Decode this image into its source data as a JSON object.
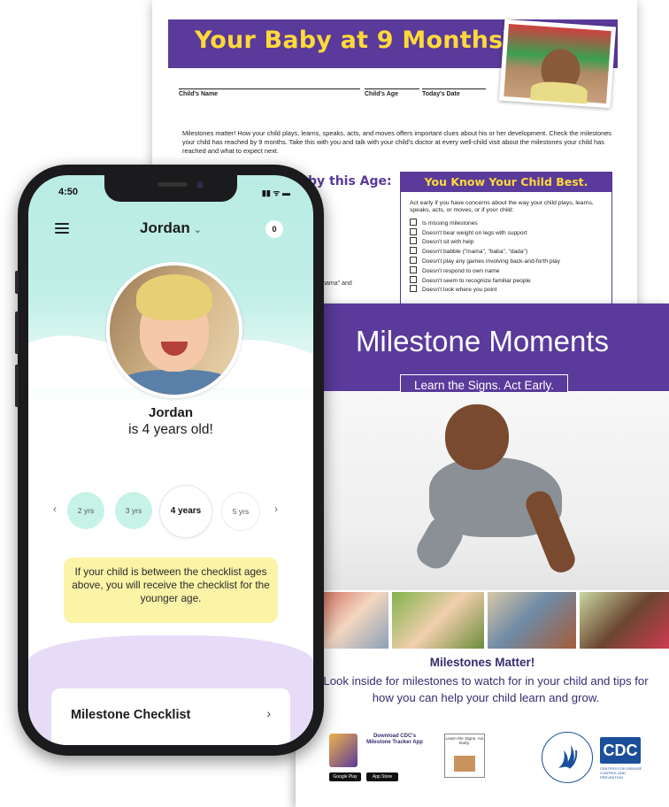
{
  "doc9": {
    "title": "Your Baby at 9 Months",
    "title_mark": "*",
    "fields": [
      "Child's Name",
      "Child's Age",
      "Today's Date"
    ],
    "intro": "Milestones matter! How your child plays, learns, speaks, acts, and moves offers important clues about his or her development. Check the milestones your child has reached by 9 months. Take this with you and talk with your child's doctor at every well-child visit about the milestones your child has reached and what to expect next.",
    "left_heading": "by this Age:",
    "partial_text": "\"mamama\" and",
    "box_title": "You Know Your Child Best.",
    "box_intro": "Act early if you have concerns about the way your child plays, learns, speaks, acts, or moves, or if your child:",
    "box_items": [
      "Is missing milestones",
      "Doesn't bear weight on legs with support",
      "Doesn't sit with help",
      "Doesn't babble (\"mama\", \"baba\", \"dada\")",
      "Doesn't play any games involving back-and-forth play",
      "Doesn't respond to own name",
      "Doesn't seem to recognize familiar people",
      "Doesn't look where you point"
    ]
  },
  "moments": {
    "title": "Milestone Moments",
    "tagline": "Learn the Signs. Act Early.",
    "matter": "Milestones Matter!",
    "look_inside": "Look inside for milestones to watch for in your child and tips for how you can help your child learn and grow.",
    "app_text": "Download CDC's Milestone Tracker App",
    "store_google": "Google Play",
    "store_apple": "App Store",
    "ltsa_text": "Learn the Signs. Act Early.",
    "cdc": "CDC",
    "cdc_sub": "CENTERS FOR DISEASE CONTROL AND PREVENTION"
  },
  "phone": {
    "time": "4:50",
    "status_icons": "▮▮ ᯤ ▬",
    "child_name": "Jordan",
    "child_chevron": "⌄",
    "notification_count": "0",
    "greeting_name": "Jordan",
    "greeting_age": "is 4 years old!",
    "ages_prev": "‹",
    "ages_next": "›",
    "ages": [
      "2 yrs",
      "3 yrs",
      "4 years",
      "5 yrs"
    ],
    "note": "If your child is between the checklist ages above, you will receive the checklist for the younger age.",
    "card_label": "Milestone Checklist",
    "card_chevron": "›"
  },
  "colors": {
    "brand_purple": "#5a3a9a",
    "title_yellow": "#ffd93a",
    "mint": "#c7f2e8",
    "note_yellow": "#fbf4a7",
    "lavender": "#e6dcf7",
    "cdc_blue": "#1b4f9b"
  },
  "icons": [
    "menu-icon",
    "chevron-down-icon",
    "chevron-left-icon",
    "chevron-right-icon",
    "signal-icon",
    "wifi-icon",
    "battery-icon",
    "hhs-eagle-icon",
    "cdc-logo"
  ]
}
